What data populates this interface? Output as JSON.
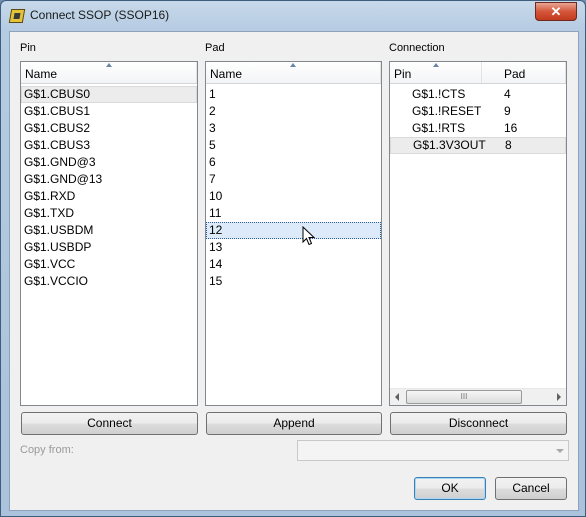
{
  "window": {
    "title": "Connect SSOP (SSOP16)",
    "close_label": "✕"
  },
  "pin_panel": {
    "label": "Pin",
    "column": "Name",
    "items": [
      "G$1.CBUS0",
      "G$1.CBUS1",
      "G$1.CBUS2",
      "G$1.CBUS3",
      "G$1.GND@3",
      "G$1.GND@13",
      "G$1.RXD",
      "G$1.TXD",
      "G$1.USBDM",
      "G$1.USBDP",
      "G$1.VCC",
      "G$1.VCCIO"
    ],
    "selected_index": 0
  },
  "pad_panel": {
    "label": "Pad",
    "column": "Name",
    "items": [
      "1",
      "2",
      "3",
      "5",
      "6",
      "7",
      "10",
      "11",
      "12",
      "13",
      "14",
      "15"
    ],
    "selected_index": 8
  },
  "connection_panel": {
    "label": "Connection",
    "columns": [
      "Pin",
      "Pad"
    ],
    "rows": [
      {
        "pin": "G$1.!CTS",
        "pad": "4"
      },
      {
        "pin": "G$1.!RESET",
        "pad": "9"
      },
      {
        "pin": "G$1.!RTS",
        "pad": "16"
      },
      {
        "pin": "G$1.3V3OUT",
        "pad": "8"
      }
    ],
    "selected_index": 3,
    "scroll_thumb_glyph": "III"
  },
  "buttons": {
    "connect": "Connect",
    "append": "Append",
    "disconnect": "Disconnect",
    "ok": "OK",
    "cancel": "Cancel"
  },
  "copy_from": {
    "label": "Copy from:",
    "value": ""
  }
}
